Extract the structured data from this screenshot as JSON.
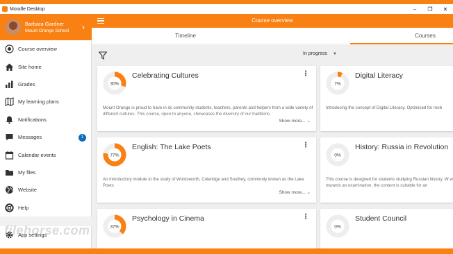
{
  "window": {
    "title": "Moodle Desktop",
    "controls": [
      "–",
      "❐",
      "✕"
    ]
  },
  "colors": {
    "brand": "#f98012",
    "badge": "#0f6cbf",
    "ring_track": "#eeeeee"
  },
  "profile": {
    "name": "Barbara Gardner",
    "school": "Mount Orange School"
  },
  "sidebar": {
    "items": [
      {
        "label": "Course overview",
        "icon": "course-overview-icon"
      },
      {
        "label": "Site home",
        "icon": "home-icon"
      },
      {
        "label": "Grades",
        "icon": "grades-icon"
      },
      {
        "label": "My learning plans",
        "icon": "map-icon"
      },
      {
        "label": "Notifications",
        "icon": "bell-icon"
      },
      {
        "label": "Messages",
        "icon": "chat-icon",
        "badge": "1"
      },
      {
        "label": "Calendar events",
        "icon": "calendar-icon"
      },
      {
        "label": "My files",
        "icon": "folder-icon"
      },
      {
        "label": "Website",
        "icon": "globe-icon"
      },
      {
        "label": "Help",
        "icon": "help-icon"
      }
    ],
    "settings_label": "App settings"
  },
  "header": {
    "title": "Course overview"
  },
  "tabs": [
    {
      "label": "Timeline"
    },
    {
      "label": "Courses"
    }
  ],
  "filter": {
    "status": "In progress"
  },
  "courses": [
    {
      "title": "Celebrating Cultures",
      "progress": 30,
      "progress_label": "30%",
      "desc": "Mount Orange is proud to have in its community students, teachers, parents and helpers from a wide variety of different cultures. This course, open to anyone, showcases the diversity of our traditions.",
      "show_more": "Show more..."
    },
    {
      "title": "Digital Literacy",
      "progress": 7,
      "progress_label": "7%",
      "desc": "Introducing the concept of Digital Literacy. Optimised for mob",
      "show_more": ""
    },
    {
      "title": "English: The Lake Poets",
      "progress": 77,
      "progress_label": "77%",
      "desc": "An introductory module to the study of Wordsworth, Coleridge and Southey, commonly known as the Lake Poets",
      "show_more": "Show more..."
    },
    {
      "title": "History: Russia in Revolution",
      "progress": 0,
      "progress_label": "0%",
      "desc": "This course is designed for students studying Russian history. W working towards an examination, the content is suitable for an",
      "show_more": ""
    },
    {
      "title": "Psychology in Cinema",
      "progress": 37,
      "progress_label": "37%",
      "desc": "",
      "show_more": ""
    },
    {
      "title": "Student Council",
      "progress": 0,
      "progress_label": "0%",
      "desc": "",
      "show_more": ""
    }
  ],
  "watermark": "filehorse.com"
}
